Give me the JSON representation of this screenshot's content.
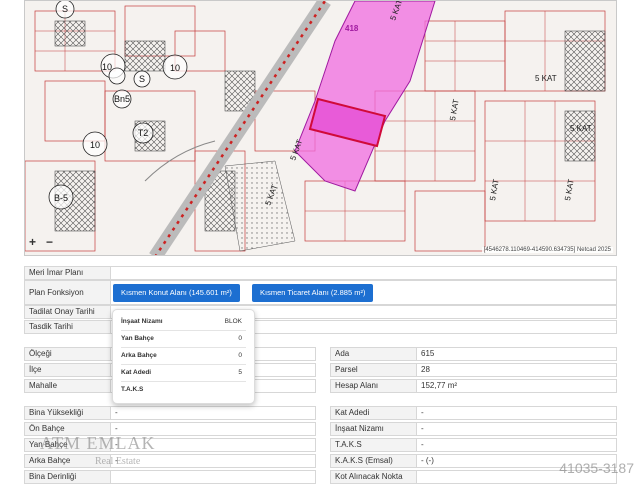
{
  "map": {
    "zoom_in": "+",
    "zoom_out": "−",
    "coords_text": "[4546278.110469-414590.634735] Netcad 2025",
    "labels": [
      "418",
      "5 KAT",
      "5 KAT",
      "5 KAT",
      "5 KAT",
      "5 KAT",
      "5 KAT",
      "5 KAT",
      "5 KAT",
      "T2",
      "10",
      "10",
      "10",
      "B-5",
      "Bn5",
      "S",
      "S",
      "S"
    ]
  },
  "upper_rows": {
    "imar_plani_label": "Meri İmar Planı",
    "plan_fonksiyon_label": "Plan Fonksiyon",
    "tadilat_label": "Tadilat Onay Tarihi",
    "tasdik_label": "Tasdik Tarihi"
  },
  "buttons": {
    "konut": "Kısmen Konut Alanı (145.601 m²)",
    "ticaret": "Kısmen Ticaret Alanı (2.885 m²)"
  },
  "tooltip": {
    "rows": [
      {
        "label": "İnşaat Nizamı",
        "value": "BLOK"
      },
      {
        "label": "Yan Bahçe",
        "value": "0"
      },
      {
        "label": "Arka Bahçe",
        "value": "0"
      },
      {
        "label": "Kat Adedi",
        "value": "5"
      },
      {
        "label": "T.A.K.S",
        "value": ""
      }
    ]
  },
  "left_mid": {
    "olcegi_label": "Ölçeği",
    "ilce_label": "İlçe",
    "mahalle_label": "Mahalle"
  },
  "right_mid": {
    "ada_label": "Ada",
    "ada_value": "615",
    "parsel_label": "Parsel",
    "parsel_value": "28",
    "hesap_label": "Hesap Alanı",
    "hesap_value": "152,77 m²"
  },
  "left_bottom": {
    "bina_yuk_label": "Bina Yüksekliği",
    "bina_yuk_value": "-",
    "on_bahce_label": "Ön Bahçe",
    "on_bahce_value": "-",
    "yan_bahce_label": "Yan Bahçe",
    "yan_bahce_value": "-",
    "arka_bahce_label": "Arka Bahçe",
    "arka_bahce_value": "-",
    "bina_derinligi_label": "Bina Derinliği"
  },
  "right_bottom": {
    "kat_adedi_label": "Kat Adedi",
    "kat_adedi_value": "-",
    "insaat_label": "İnşaat Nizamı",
    "insaat_value": "-",
    "taks_label": "T.A.K.S",
    "taks_value": "-",
    "kaks_label": "K.A.K.S (Emsal)",
    "kaks_value": "- (-)",
    "kot_label": "Kot Alınacak Nokta"
  },
  "watermark": {
    "name": "ATM EMLAK",
    "sub": "Real Estate",
    "phone": "41035-3187"
  }
}
